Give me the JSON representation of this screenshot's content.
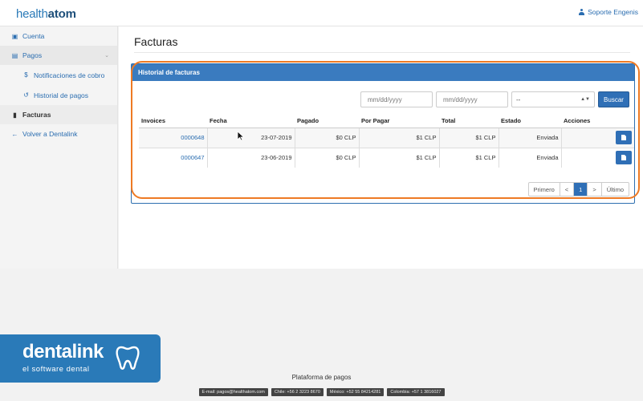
{
  "header": {
    "logo_prefix": "health",
    "logo_suffix": "atom",
    "user_label": "Soporte Engenis"
  },
  "sidebar": {
    "items": [
      {
        "label": "Cuenta",
        "icon": "bank-icon"
      },
      {
        "label": "Pagos",
        "icon": "money-icon"
      },
      {
        "label": "Notificaciones de cobro",
        "icon": "dollar-icon"
      },
      {
        "label": "Historial de pagos",
        "icon": "history-icon"
      },
      {
        "label": "Facturas",
        "icon": "file-icon"
      },
      {
        "label": "Volver a Dentalink",
        "icon": "arrow-left-icon"
      }
    ]
  },
  "main": {
    "title": "Facturas",
    "panel_title": "Historial de facturas",
    "filters": {
      "date_from_placeholder": "mm/dd/yyyy",
      "date_to_placeholder": "mm/dd/yyyy",
      "estado_value": "--",
      "search_label": "Buscar"
    },
    "table": {
      "headers": [
        "Invoices",
        "Fecha",
        "Pagado",
        "Por Pagar",
        "Total",
        "Estado",
        "Acciones"
      ],
      "rows": [
        {
          "invoice": "0000648",
          "fecha": "23-07-2019",
          "pagado": "$0 CLP",
          "por_pagar": "$1 CLP",
          "total": "$1 CLP",
          "estado": "Enviada"
        },
        {
          "invoice": "0000647",
          "fecha": "23-06-2019",
          "pagado": "$0 CLP",
          "por_pagar": "$1 CLP",
          "total": "$1 CLP",
          "estado": "Enviada"
        }
      ]
    },
    "pager": {
      "first": "Primero",
      "prev": "<",
      "current": "1",
      "next": ">",
      "last": "Último"
    }
  },
  "footer": {
    "title": "Plataforma de pagos",
    "badges": [
      "E-mail: pagos@healthatom.com",
      "Chile: +56 2 3223 8670",
      "México: +52 55 84214281",
      "Colombia: +57 1 3816027"
    ]
  },
  "brand": {
    "name": "dentalink",
    "tagline": "el software dental"
  },
  "colors": {
    "accent": "#2f6fb6",
    "highlight": "#ee7a24",
    "brand": "#2a7ab8"
  }
}
